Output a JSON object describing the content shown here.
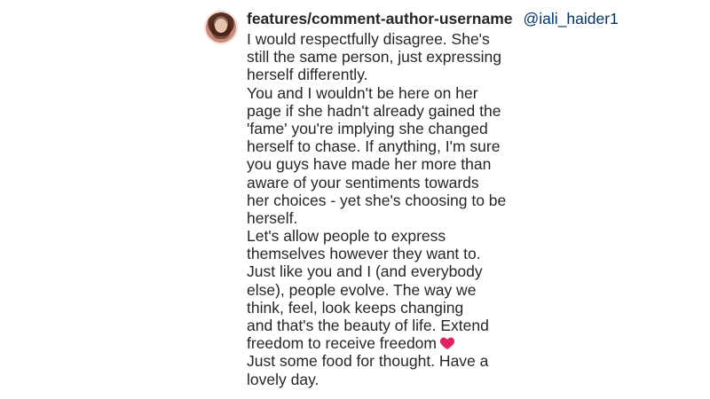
{
  "comment": {
    "username": "features/comment-author-username",
    "mention": "@iali_haider1",
    "verified_icon": "verified-badge-icon",
    "heart_icon": "red-heart-icon",
    "colors": {
      "text": "#262626",
      "mention": "#00376b",
      "verified": "#3897f0",
      "heart": "#e0245e"
    },
    "lines": [
      "I would respectfully disagree. She's",
      "still the same person, just expressing",
      "herself differently.",
      "You and I wouldn't be here on her",
      "page if she hadn't already gained the",
      "'fame' you're implying she changed",
      "herself to chase. If anything, I'm sure",
      "you guys have made her more than",
      "aware of your sentiments towards",
      "her choices - yet she's choosing to be",
      "herself.",
      "Let's allow people to express",
      "themselves however they want to.",
      "Just like you and I (and everybody",
      "else), people evolve. The way we",
      "think, feel, look keeps changing",
      "and that's the beauty of life. Extend",
      "freedom to receive freedom",
      "Just some food for thought. Have a",
      "lovely day."
    ]
  }
}
